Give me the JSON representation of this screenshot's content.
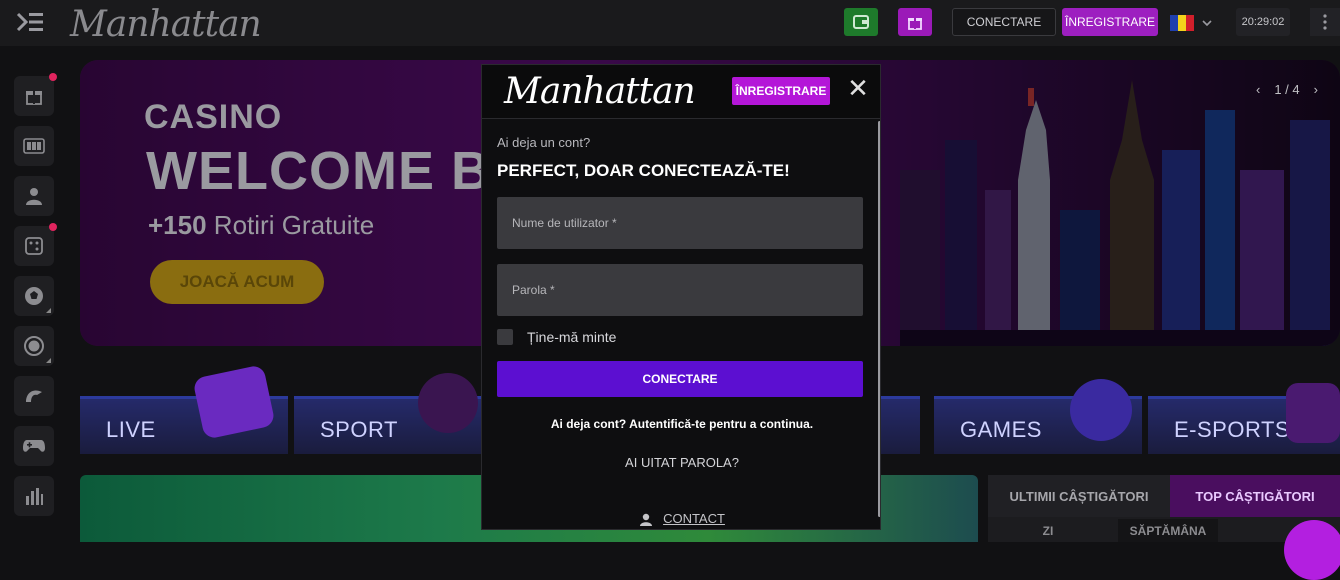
{
  "header": {
    "brand": "Manhattan",
    "login_label": "CONECTARE",
    "register_label": "ÎNREGISTRARE",
    "clock": "20:29:02",
    "flag_colors": [
      "#1f3fae",
      "#f3d31b",
      "#d11f2b"
    ],
    "icons": [
      "menu-toggle-icon",
      "wallet-icon",
      "gift-icon",
      "chevron-down-icon",
      "more-dots-icon"
    ]
  },
  "sidebar": {
    "items": [
      {
        "icon": "gift-icon",
        "badge": true,
        "submenu": false
      },
      {
        "icon": "slots-icon",
        "badge": false,
        "submenu": false
      },
      {
        "icon": "live-dealer-icon",
        "badge": false,
        "submenu": false
      },
      {
        "icon": "dice-icon",
        "badge": true,
        "submenu": false
      },
      {
        "icon": "football-icon",
        "badge": false,
        "submenu": true
      },
      {
        "icon": "live-bet-icon",
        "badge": false,
        "submenu": true
      },
      {
        "icon": "virtual-sports-icon",
        "badge": false,
        "submenu": false
      },
      {
        "icon": "gamepad-icon",
        "badge": false,
        "submenu": false
      },
      {
        "icon": "stats-icon",
        "badge": false,
        "submenu": false
      }
    ]
  },
  "banner": {
    "line1": "CASINO",
    "line2": "WELCOME B",
    "spins_bold": "+150",
    "spins_text": " Rotiri Gratuite",
    "cta": "JOACĂ ACUM",
    "pager": "1 / 4",
    "accent": "#6b1188"
  },
  "categories": [
    {
      "label": "LIVE"
    },
    {
      "label": "SPORT"
    },
    {
      "label": "GAMES"
    },
    {
      "label": "E-SPORTS"
    }
  ],
  "winners": {
    "tab_latest": "ULTIMII CÂȘTIGĂTORI",
    "tab_top": "TOP CÂȘTIGĂTORI",
    "sub1": "ZI",
    "sub2": "SĂPTĂMÂNA"
  },
  "modal": {
    "brand": "Manhattan",
    "register_label": "ÎNREGISTRARE",
    "close_glyph": "✕",
    "subtitle": "Ai deja un cont?",
    "title": "PERFECT, DOAR CONECTEAZĂ-TE!",
    "username_placeholder": "Nume de utilizator *",
    "password_placeholder": "Parola *",
    "remember_label": "Ține-mă minte",
    "login_button": "CONECTARE",
    "note": "Ai deja cont? Autentifică-te pentru a continua.",
    "forgot": "AI UITAT PAROLA?",
    "contact": "CONTACT",
    "accent_register": "#b416d8",
    "accent_login": "#5c0fd1"
  }
}
